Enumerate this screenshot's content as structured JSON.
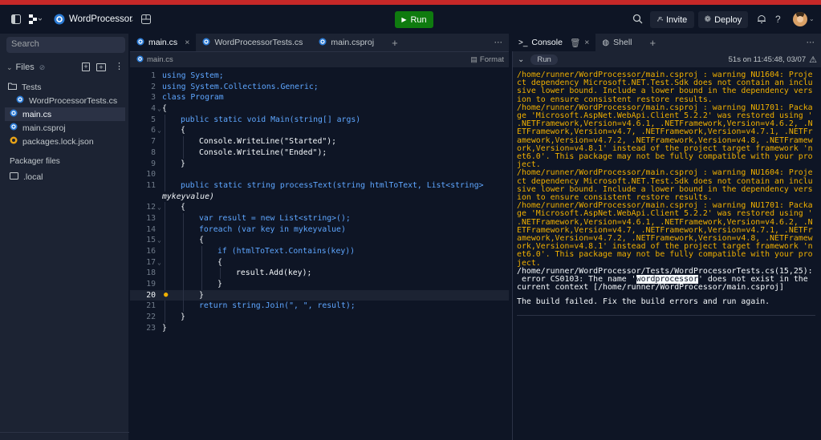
{
  "topbar": {
    "project_name": "WordProcessor",
    "run_label": "Run",
    "invite_label": "Invite",
    "deploy_label": "Deploy",
    "help_label": "?"
  },
  "sidebar": {
    "search_placeholder": "Search",
    "files_label": "Files",
    "items": [
      {
        "label": "Tests"
      },
      {
        "label": "WordProcessorTests.cs"
      },
      {
        "label": "main.cs"
      },
      {
        "label": "main.csproj"
      },
      {
        "label": "packages.lock.json"
      }
    ],
    "packager_label": "Packager files",
    "local_label": ".local"
  },
  "editor": {
    "tabs": [
      {
        "label": "main.cs"
      },
      {
        "label": "WordProcessorTests.cs"
      },
      {
        "label": "main.csproj"
      }
    ],
    "breadcrumb": "main.cs",
    "format_label": "Format",
    "line_numbers": [
      "1",
      "2",
      "3",
      "4",
      "5",
      "6",
      "7",
      "8",
      "9",
      "10",
      "11",
      "",
      "12",
      "13",
      "14",
      "15",
      "16",
      "17",
      "18",
      "19",
      "20",
      "21",
      "22",
      "23"
    ],
    "code_text": {
      "l1": "using System;",
      "l2": "using System.Collections.Generic;",
      "l3": "class Program",
      "l4": "{",
      "l5": "public static void Main(string[] args)",
      "l6": "{",
      "l7": "Console.WriteLine(\"Started\");",
      "l8": "Console.WriteLine(\"Ended\");",
      "l9": "}",
      "l11a": "public static string processText(string htmlToText, List<string>",
      "l11b": "mykeyvalue)",
      "l12": "{",
      "l13": "var result = new List<string>();",
      "l14": "foreach (var key in mykeyvalue)",
      "l15": "{",
      "l16": "if (htmlToText.Contains(key))",
      "l17": "{",
      "l18": "result.Add(key);",
      "l19": "}",
      "l20": "}",
      "l21": "return string.Join(\", \", result);",
      "l22": "}",
      "l23": "}"
    }
  },
  "console": {
    "tabs": [
      {
        "label": "Console"
      },
      {
        "label": "Shell"
      }
    ],
    "run_pill": "Run",
    "run_info": "51s on 11:45:48, 03/07",
    "output_lines": [
      {
        "t": "/home/runner/WordProcessor/main.csproj : warning NU1604: Proje",
        "c": "w"
      },
      {
        "t": "ct dependency Microsoft.NET.Test.Sdk does not contain an inclu",
        "c": "w"
      },
      {
        "t": "sive lower bound. Include a lower bound in the dependency vers",
        "c": "w"
      },
      {
        "t": "ion to ensure consistent restore results.",
        "c": "w"
      },
      {
        "t": "/home/runner/WordProcessor/main.csproj : warning NU1701: Packa",
        "c": "w"
      },
      {
        "t": "ge 'Microsoft.AspNet.WebApi.Client 5.2.2' was restored using '",
        "c": "w"
      },
      {
        "t": ".NETFramework,Version=v4.6.1, .NETFramework,Version=v4.6.2, .N",
        "c": "w"
      },
      {
        "t": "ETFramework,Version=v4.7, .NETFramework,Version=v4.7.1, .NETFr",
        "c": "w"
      },
      {
        "t": "amework,Version=v4.7.2, .NETFramework,Version=v4.8, .NETFramew",
        "c": "w"
      },
      {
        "t": "ork,Version=v4.8.1' instead of the project target framework 'n",
        "c": "w"
      },
      {
        "t": "et6.0'. This package may not be fully compatible with your pro",
        "c": "w"
      },
      {
        "t": "ject.",
        "c": "w"
      },
      {
        "t": "/home/runner/WordProcessor/main.csproj : warning NU1604: Proje",
        "c": "w"
      },
      {
        "t": "ct dependency Microsoft.NET.Test.Sdk does not contain an inclu",
        "c": "w"
      },
      {
        "t": "sive lower bound. Include a lower bound in the dependency vers",
        "c": "w"
      },
      {
        "t": "ion to ensure consistent restore results.",
        "c": "w"
      },
      {
        "t": "/home/runner/WordProcessor/main.csproj : warning NU1701: Packa",
        "c": "w"
      },
      {
        "t": "ge 'Microsoft.AspNet.WebApi.Client 5.2.2' was restored using '",
        "c": "w"
      },
      {
        "t": ".NETFramework,Version=v4.6.1, .NETFramework,Version=v4.6.2, .N",
        "c": "w"
      },
      {
        "t": "ETFramework,Version=v4.7, .NETFramework,Version=v4.7.1, .NETFr",
        "c": "w"
      },
      {
        "t": "amework,Version=v4.7.2, .NETFramework,Version=v4.8, .NETFramew",
        "c": "w"
      },
      {
        "t": "ork,Version=v4.8.1' instead of the project target framework 'n",
        "c": "w"
      },
      {
        "t": "et6.0'. This package may not be fully compatible with your pro",
        "c": "w"
      },
      {
        "t": "ject.",
        "c": "w"
      },
      {
        "t": "/home/runner/WordProcessor/Tests/WordProcessorTests.cs(15,25):",
        "c": "n"
      }
    ],
    "error_pre": " error CS0103: The name '",
    "error_highlight": "wordprocessor",
    "error_post": "' does not exist in the",
    "error_line2": "current context [/home/runner/WordProcessor/main.csproj]",
    "build_failed": "The build failed. Fix the build errors and run again."
  },
  "colors": {
    "background": "#0e1525",
    "panel": "#1c2333",
    "run_button": "#0f7b0f",
    "warning": "#f0b000",
    "keyword": "#5ea6ff",
    "type": "#ffcb6b",
    "accent_bar": "#c62828"
  },
  "icons": [
    "panel-toggle-icon",
    "replit-logo-icon",
    "csharp-icon",
    "layout-icon",
    "play-icon",
    "search-icon",
    "invite-icon",
    "deploy-icon",
    "bell-icon",
    "avatar",
    "folder-icon",
    "file-icon",
    "json-icon",
    "lightbulb-icon",
    "console-icon",
    "trash-icon",
    "shell-icon",
    "warning-icon"
  ]
}
